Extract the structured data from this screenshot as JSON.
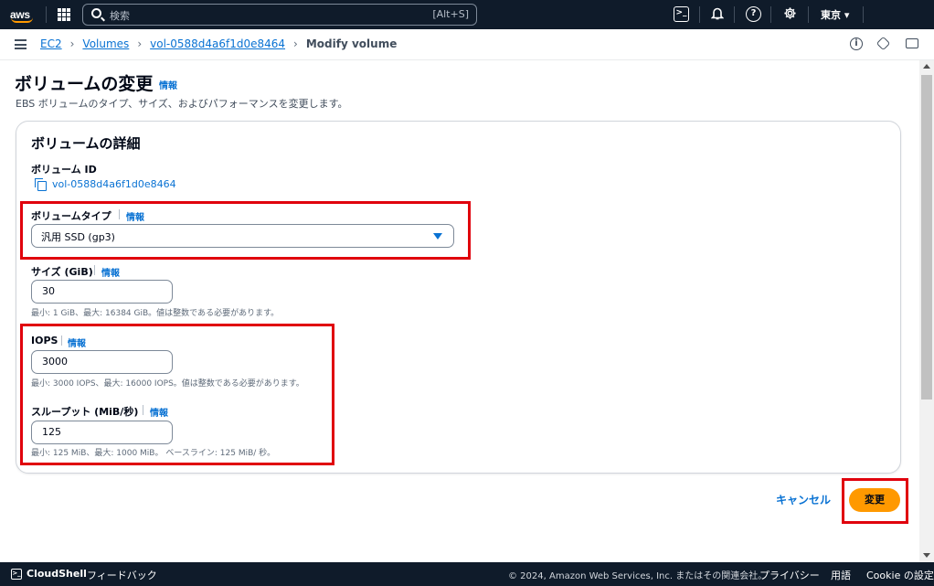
{
  "topnav": {
    "logo_text": "aws",
    "search_placeholder": "検索",
    "search_shortcut": "[Alt+S]",
    "region": "東京 ▾",
    "icons": [
      "grid-icon",
      "cloudshell-icon",
      "bell-icon",
      "help-icon",
      "gear-icon"
    ]
  },
  "breadcrumb": {
    "items": [
      "EC2",
      "Volumes",
      "vol-0588d4a6f1d0e8464"
    ],
    "current": "Modify volume"
  },
  "page": {
    "title": "ボリュームの変更",
    "info": "情報",
    "description": "EBS ボリュームのタイプ、サイズ、およびパフォーマンスを変更します。"
  },
  "panel": {
    "title": "ボリュームの詳細",
    "volume_id_label": "ボリューム ID",
    "volume_id": "vol-0588d4a6f1d0e8464",
    "volume_type_label": "ボリュームタイプ",
    "volume_type_value": "汎用 SSD (gp3)",
    "size_label": "サイズ (GiB)",
    "size_value": "30",
    "size_hint": "最小: 1 GiB、最大: 16384 GiB。値は整数である必要があります。",
    "iops_label": "IOPS",
    "iops_value": "3000",
    "iops_hint": "最小: 3000 IOPS、最大: 16000 IOPS。値は整数である必要があります。",
    "throughput_label": "スループット (MiB/秒)",
    "throughput_value": "125",
    "throughput_hint": "最小: 125 MiB、最大: 1000 MiB。 ベースライン: 125 MiB/ 秒。",
    "info": "情報"
  },
  "actions": {
    "cancel": "キャンセル",
    "submit": "変更"
  },
  "footer": {
    "cloudshell": "CloudShell",
    "feedback": "フィードバック",
    "copyright": "© 2024, Amazon Web Services, Inc. またはその関連会社。",
    "privacy": "プライバシー",
    "terms": "用語",
    "cookie": "Cookie の設定"
  },
  "colors": {
    "nav_bg": "#0f1b2a",
    "link": "#0972d3",
    "primary_button": "#ff9900",
    "highlight": "#e0000c"
  }
}
